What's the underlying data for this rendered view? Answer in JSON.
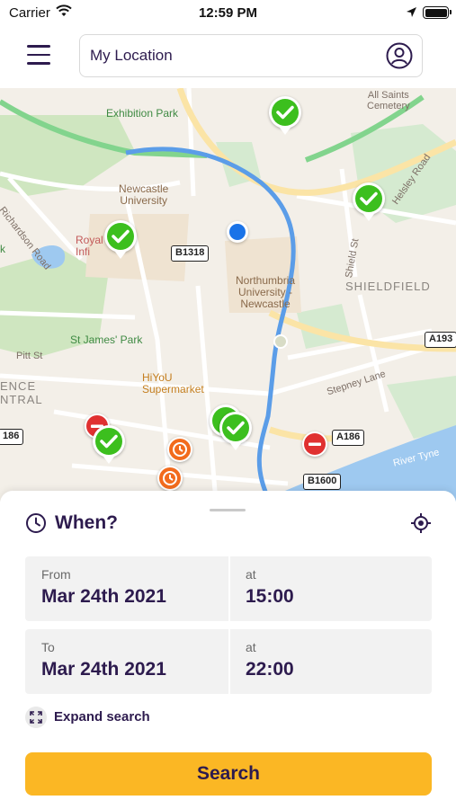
{
  "status_bar": {
    "carrier": "Carrier",
    "time": "12:59 PM"
  },
  "header": {
    "search_value": "My Location",
    "icons": {
      "menu": "hamburger-menu-icon",
      "profile": "user-avatar-icon"
    }
  },
  "map": {
    "labels": {
      "exhibition_park": "Exhibition Park",
      "newcastle_university": "Newcastle\nUniversity",
      "richardson_road": "Richardson Road",
      "royal_infirmary": "Royal\nInfi",
      "park_fragment": "k",
      "northumbria": "Northumbria\nUniversity -\nNewcastle",
      "shieldfield": "SHIELDFIELD",
      "shield_st": "Shield St",
      "st_james_park": "St James' Park",
      "pitt_st": "Pitt St",
      "hiyou": "HiYoU\nSupermarket",
      "science_central": "ENCE\nNTRAL",
      "stepney_lane": "Stepney Lane",
      "river_tyne": "River Tyne",
      "all_saints": "All Saints\nCemetery",
      "helsley_road": "Helsley Road"
    },
    "road_shields": {
      "b1318": "B1318",
      "a193": "A193",
      "a186": "A186",
      "a186_left": "186",
      "b1600": "B1600"
    },
    "pins": [
      "available",
      "available",
      "available",
      "available",
      "available",
      "available",
      "no-entry",
      "no-entry",
      "time-limited",
      "time-limited"
    ]
  },
  "sheet": {
    "title": "When?",
    "from": {
      "label": "From",
      "date": "Mar 24th 2021",
      "time_label": "at",
      "time": "15:00"
    },
    "to": {
      "label": "To",
      "date": "Mar 24th 2021",
      "time_label": "at",
      "time": "22:00"
    },
    "expand_label": "Expand search",
    "search_label": "Search"
  },
  "colors": {
    "brand_dark": "#2d1b4e",
    "accent_yellow": "#fbb724",
    "pin_available": "#3cbf1e",
    "pin_blocked": "#e03030",
    "pin_clock": "#f26b1d",
    "route_blue": "#5b9de8"
  }
}
